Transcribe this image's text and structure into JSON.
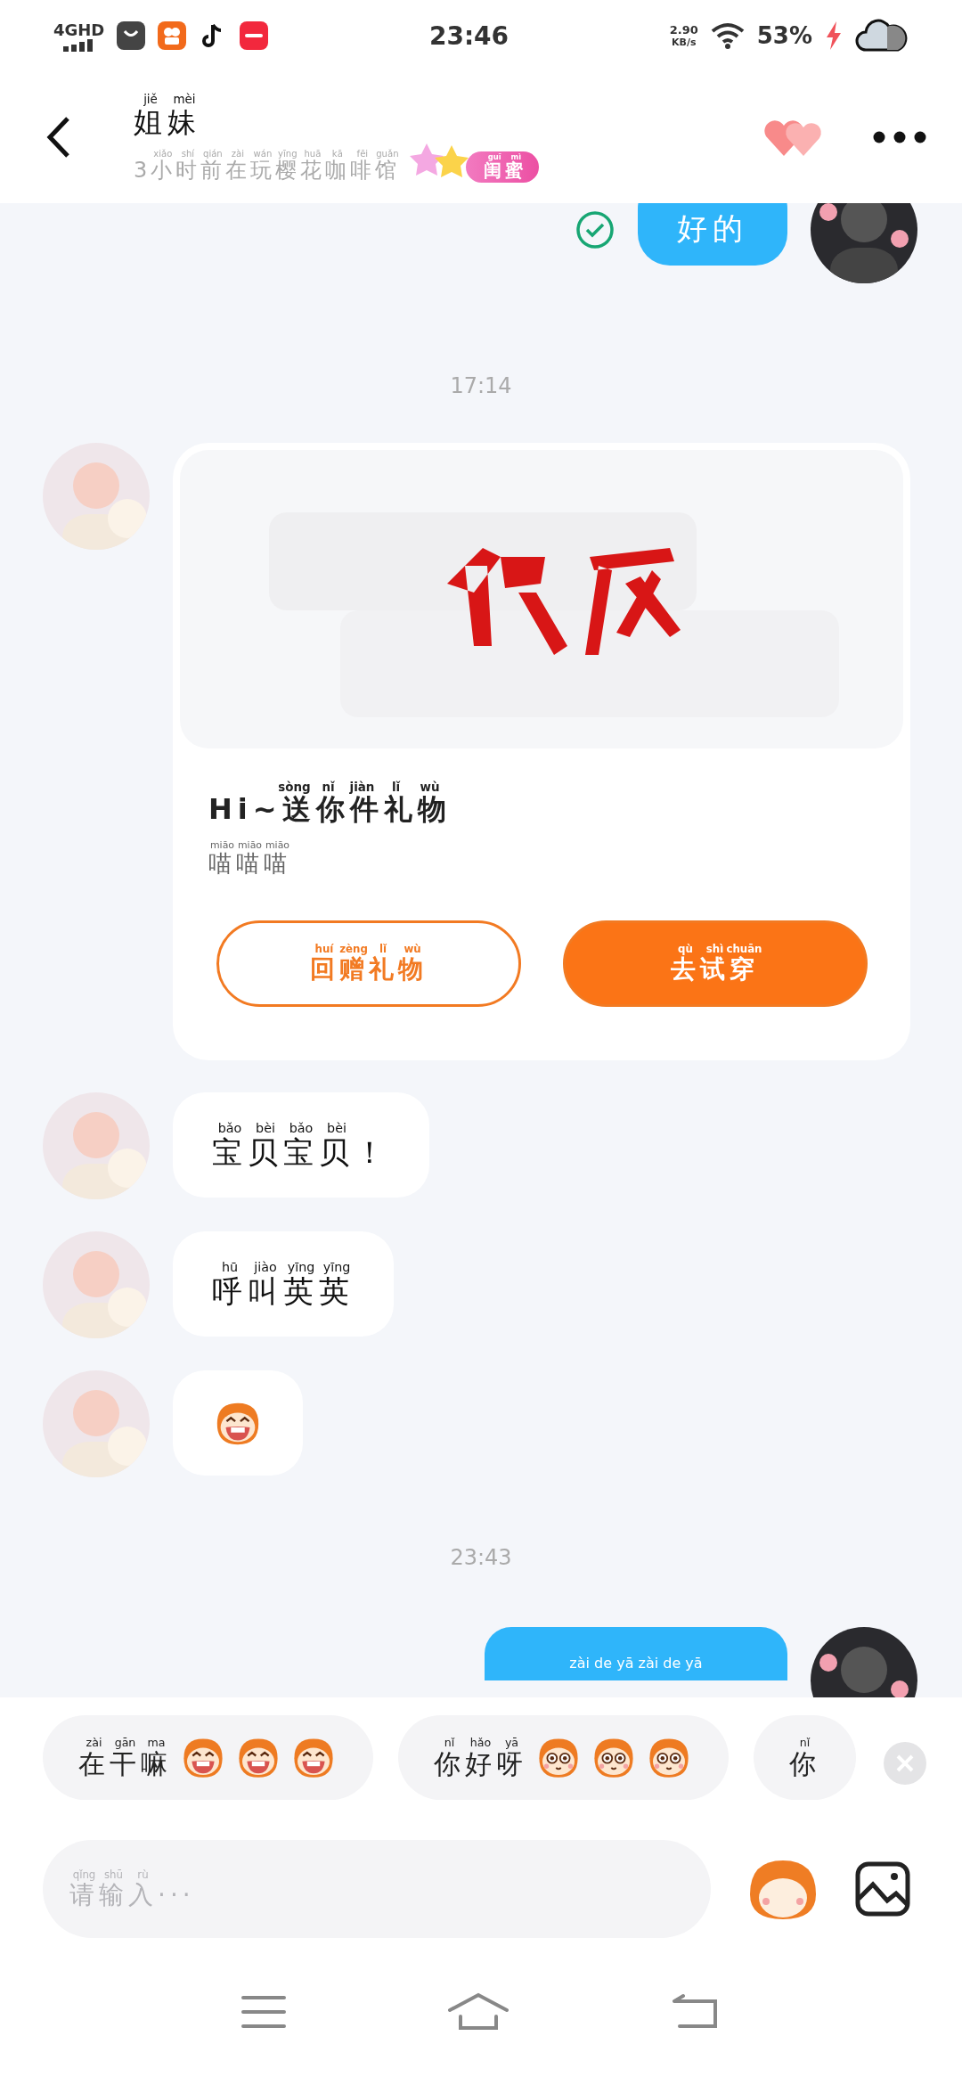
{
  "status_bar": {
    "network": "4GHD",
    "time": "23:46",
    "speed": "2.90",
    "speed_unit": "KB/s",
    "battery": "53%",
    "charging": true
  },
  "header": {
    "title": {
      "text": "姐妹",
      "pinyin": [
        "jiě",
        "mèi"
      ]
    },
    "subtitle": {
      "text": "3小时前在玩樱花咖啡馆",
      "pinyin": [
        "xiǎo",
        "shí",
        "qián",
        "zài",
        "wán",
        "yīng",
        "huā",
        "kā",
        "fēi",
        "guǎn"
      ]
    },
    "badge": {
      "text": "闺蜜",
      "pinyin": [
        "guī",
        "mì"
      ]
    }
  },
  "messages": [
    {
      "kind": "text",
      "outgoing": true,
      "text": "好的",
      "read": true
    },
    {
      "kind": "time",
      "text": "17:14"
    },
    {
      "kind": "gift",
      "outgoing": false,
      "title": {
        "text": "Hi~送你件礼物",
        "pinyin": [
          "sòng",
          "nǐ",
          "jiàn",
          "lǐ",
          "wù"
        ]
      },
      "subtitle": {
        "text": "喵喵喵",
        "pinyin": [
          "miāo",
          "miāo",
          "miāo"
        ]
      },
      "buttons": [
        {
          "text": "回赠礼物",
          "pinyin": [
            "huí",
            "zèng",
            "lǐ",
            "wù"
          ],
          "primary": false
        },
        {
          "text": "去试穿",
          "pinyin": [
            "qù",
            "shì",
            "chuān"
          ],
          "primary": true
        }
      ]
    },
    {
      "kind": "text",
      "outgoing": false,
      "text": "宝贝宝贝！",
      "pinyin": [
        "bǎo",
        "bèi",
        "bǎo",
        "bèi"
      ]
    },
    {
      "kind": "text",
      "outgoing": false,
      "text": "呼叫英英",
      "pinyin": [
        "hū",
        "jiào",
        "yīng",
        "yīng"
      ]
    },
    {
      "kind": "emoji",
      "outgoing": false,
      "emojis": [
        {
          "kind": "grin"
        }
      ]
    },
    {
      "kind": "time",
      "text": "23:43"
    },
    {
      "kind": "partial",
      "outgoing": true,
      "pinyin": "zài de yā zài de yā"
    }
  ],
  "quick_replies": [
    {
      "text": "在干嘛",
      "pinyin": [
        "zài",
        "gān",
        "ma"
      ],
      "emojis": [
        {
          "kind": "grin"
        },
        {
          "kind": "grin"
        },
        {
          "kind": "grin"
        }
      ]
    },
    {
      "text": "你好呀",
      "pinyin": [
        "nǐ",
        "hǎo",
        "yā"
      ],
      "emojis": [
        {
          "kind": "stare"
        },
        {
          "kind": "stare"
        },
        {
          "kind": "stare"
        }
      ]
    },
    {
      "text": "你",
      "pinyin": [
        "nǐ"
      ]
    }
  ],
  "input": {
    "placeholder": {
      "text": "请输入···",
      "pinyin": [
        "qǐng",
        "shū",
        "rù"
      ]
    }
  }
}
